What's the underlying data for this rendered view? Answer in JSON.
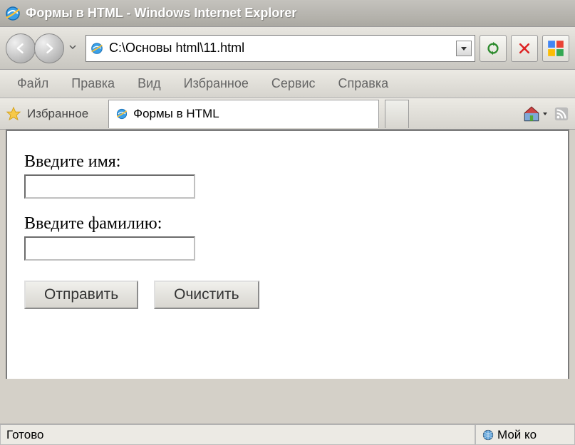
{
  "window": {
    "title": "Формы в HTML - Windows Internet Explorer"
  },
  "address": {
    "url": "C:\\Основы html\\11.html"
  },
  "menu": {
    "file": "Файл",
    "edit": "Правка",
    "view": "Вид",
    "favorites": "Избранное",
    "tools": "Сервис",
    "help": "Справка"
  },
  "favbar": {
    "label": "Избранное"
  },
  "tab": {
    "title": "Формы в HTML"
  },
  "form": {
    "name_label": "Введите имя:",
    "surname_label": "Введите фамилию:",
    "name_value": "",
    "surname_value": "",
    "submit": "Отправить",
    "reset": "Очистить"
  },
  "status": {
    "ready": "Готово",
    "zone": "Мой ко"
  }
}
